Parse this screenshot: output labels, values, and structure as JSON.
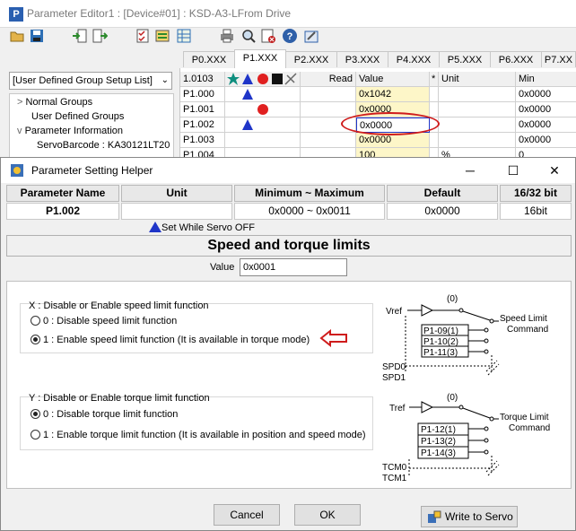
{
  "main_window": {
    "app_icon": "P",
    "title": "Parameter Editor1 : [Device#01] : KSD-A3-LFrom Drive"
  },
  "toolbar": {
    "icons": [
      "open-folder-icon",
      "save-icon",
      "import-icon",
      "export-icon",
      "checklist-icon",
      "group-icon",
      "table-icon",
      "print-icon",
      "search-icon",
      "settings-icon",
      "help-icon",
      "tools-icon"
    ]
  },
  "group_select": {
    "value": "[User Defined Group Setup List]"
  },
  "tree": {
    "items": [
      {
        "label": "Normal Groups",
        "toggle": ">"
      },
      {
        "label": "User Defined Groups",
        "toggle": ""
      },
      {
        "label": "Parameter Information",
        "toggle": "v"
      },
      {
        "label": "ServoBarcode : KA30121LT20",
        "toggle": ""
      }
    ]
  },
  "tabs": [
    "P0.XXX",
    "P1.XXX",
    "P2.XXX",
    "P3.XXX",
    "P4.XXX",
    "P5.XXX",
    "P6.XXX",
    "P7.XX"
  ],
  "active_tab": 1,
  "grid": {
    "header": {
      "param": "1.0103",
      "read": "Read",
      "value": "Value",
      "star": "*",
      "unit": "Unit",
      "min": "Min"
    },
    "rows": [
      {
        "param": "P1.000",
        "value": "0x1042",
        "unit": "",
        "min": "0x0000",
        "mark": "triangle"
      },
      {
        "param": "P1.001",
        "value": "0x0000",
        "unit": "",
        "min": "0x0000",
        "mark": "circle"
      },
      {
        "param": "P1.002",
        "value": "0x0000",
        "unit": "",
        "min": "0x0000",
        "mark": "triangle"
      },
      {
        "param": "P1.003",
        "value": "0x0000",
        "unit": "",
        "min": "0x0000",
        "mark": ""
      },
      {
        "param": "P1.004",
        "value": "100",
        "unit": "%",
        "min": "0",
        "mark": ""
      }
    ],
    "colors": {
      "triangle": "#1f35c8",
      "circle": "#e02020",
      "star": "#0f8f7f"
    }
  },
  "dialog": {
    "title": "Parameter Setting Helper",
    "controls": {
      "minimize": "─",
      "maximize": "☐",
      "close": "✕"
    },
    "columns": [
      "Parameter Name",
      "Unit",
      "Minimum ~ Maximum",
      "Default",
      "16/32 bit"
    ],
    "values": [
      "P1.002",
      "",
      "0x0000 ~ 0x0011",
      "0x0000",
      "16bit"
    ],
    "servo_off_note": "Set While Servo OFF",
    "heading": "Speed and torque limits",
    "value_label": "Value",
    "value": "0x0001",
    "group_x": {
      "label": "X : Disable or Enable speed limit function",
      "options": [
        "0 : Disable speed limit function",
        "1 : Enable speed limit function (It is available in torque mode)"
      ],
      "selected": 1
    },
    "group_y": {
      "label": "Y : Disable or Enable torque limit function",
      "options": [
        "0 : Disable torque limit function",
        "1 : Enable torque limit function (It is available in position and speed mode)"
      ],
      "selected": 0
    },
    "speed_diagram": {
      "input": "Vref",
      "zero": "(0)",
      "params": [
        "P1-09(1)",
        "P1-10(2)",
        "P1-11(3)"
      ],
      "output_line1": "Speed Limit",
      "output_line2": "Command",
      "sel1": "SPD0",
      "sel2": "SPD1"
    },
    "torque_diagram": {
      "input": "Tref",
      "zero": "(0)",
      "params": [
        "P1-12(1)",
        "P1-13(2)",
        "P1-14(3)"
      ],
      "output_line1": "Torque Limit",
      "output_line2": "Command",
      "sel1": "TCM0",
      "sel2": "TCM1"
    },
    "buttons": {
      "cancel": "Cancel",
      "ok": "OK",
      "write": "Write to Servo"
    },
    "annotation_color": "#cf1c1c"
  }
}
